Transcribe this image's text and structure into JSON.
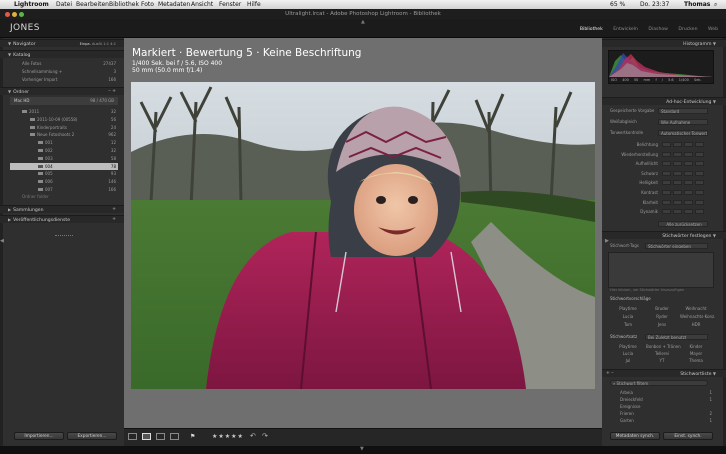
{
  "menubar": {
    "apple": "",
    "items": [
      "Lightroom",
      "Datei",
      "Bearbeiten",
      "Bibliothek",
      "Foto",
      "Metadaten",
      "Ansicht",
      "Fenster",
      "Hilfe"
    ],
    "battery": "65 %",
    "time": "Do. 23:37",
    "user": "Thomas"
  },
  "window": {
    "title": "Ultralight.lrcat - Adobe Photoshop Lightroom - Bibliothek"
  },
  "identity": {
    "plate": "JONES",
    "modules": [
      "Bibliothek",
      "Entwickeln",
      "Diashow",
      "Drucken",
      "Web"
    ]
  },
  "left": {
    "navigator": {
      "title": "Navigator",
      "zoom": [
        "Einpa.",
        "Ausfü",
        "1:1",
        "4:1"
      ]
    },
    "catalog": {
      "title": "Katalog",
      "items": [
        {
          "label": "Alle Fotos",
          "count": "27437"
        },
        {
          "label": "Schnellsammlung +",
          "count": "3"
        },
        {
          "label": "Vorheriger Import",
          "count": "166"
        }
      ]
    },
    "folders": {
      "title": "Ordner",
      "volume": "Mac HD",
      "volume_info": "98 / 470 GB",
      "items": [
        {
          "label": "2011",
          "count": "32"
        },
        {
          "label": "2011-10-09 (00558)",
          "count": "56"
        },
        {
          "label": "Kinderportraits",
          "count": "24"
        },
        {
          "label": "Neue Fotoshoots 2",
          "count": "962"
        },
        {
          "label": "001",
          "count": "12"
        },
        {
          "label": "002",
          "count": "32"
        },
        {
          "label": "003",
          "count": "58"
        },
        {
          "label": "004",
          "count": "78"
        },
        {
          "label": "005",
          "count": "93"
        },
        {
          "label": "006",
          "count": "146"
        },
        {
          "label": "007",
          "count": "166"
        }
      ],
      "more": "Ordner folder"
    },
    "collections": "Sammlungen",
    "publish": "Veröffentlichungsdienste",
    "import_btn": "Importieren...",
    "export_btn": "Exportieren..."
  },
  "overlay": {
    "line1": "Markiert · Bewertung 5 · Keine Beschriftung",
    "line2": "1/400 Sek. bei f / 5.6, ISO 400",
    "line3": "50 mm (50.0 mm f/1.4)"
  },
  "right": {
    "histogram": {
      "title": "Histogramm",
      "readout": [
        "ISO 400",
        "50 mm",
        "f / 5.6",
        "1/400 Sek."
      ]
    },
    "quick_develop": {
      "title": "Ad-hoc-Entwicklung",
      "preset_label": "Gespeicherte Vorgabe",
      "preset_value": "Standard",
      "wb_label": "Weißabgleich",
      "wb_value": "Wie Aufnahme",
      "tone_label": "Tonwertkontrolle",
      "tone_btn": "Automatischer Tonwert",
      "rows": [
        "Belichtung",
        "Wiederherstellung",
        "Aufhelllicht",
        "Schwarz",
        "Helligkeit",
        "Kontrast",
        "Klarheit",
        "Dynamik"
      ],
      "reset_btn": "Alle zurücksetzen"
    },
    "keywording": {
      "title": "Stichwörter festlegen",
      "tags_label": "Stichwort-Tags",
      "tags_value": "Stichwörter eingeben",
      "hint": "Hier klicken, um Stichwörter hinzuzufügen",
      "suggest_title": "Stichwortvorschläge",
      "suggest": [
        "Playtime",
        "Bruder",
        "Weihnacht",
        "Lucia",
        "Ryder",
        "Weihnachts-Konz.",
        "Tom",
        "Jens",
        "HDR"
      ],
      "set_label": "Stichwortsatz",
      "set_value": "Bei Zuletzt benutzt",
      "set": [
        "Playtime",
        "Bonbon + Tränen",
        "Kinder",
        "Lucia",
        "Tellerei",
        "Mayer",
        "Jul",
        "YT",
        "Thema"
      ]
    },
    "keyword_list": {
      "title": "Stichwortliste",
      "filter": "Stichwort filtern",
      "items": [
        {
          "label": "Arbeia",
          "count": "1"
        },
        {
          "label": "Dreieckfeld",
          "count": "1"
        },
        {
          "label": "Ereignisse",
          "count": ""
        },
        {
          "label": "Frieren",
          "count": "2"
        },
        {
          "label": "Garten",
          "count": "1"
        }
      ]
    },
    "sync_btn": "Metadaten synch.",
    "sync2_btn": "Einst. synch."
  },
  "toolbar": {
    "stars": "★★★★★",
    "flag": "⚑"
  }
}
